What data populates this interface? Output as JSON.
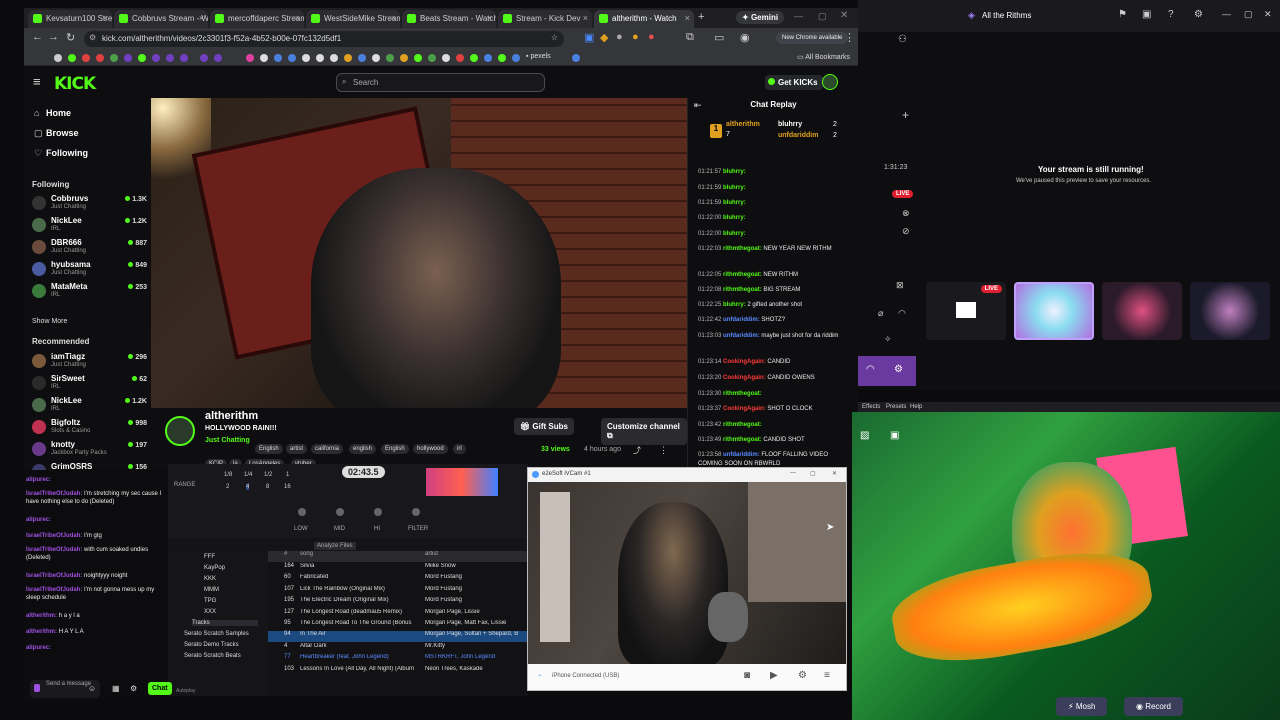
{
  "browser": {
    "tabs": [
      {
        "label": "Kevsaturn100 Stream"
      },
      {
        "label": "Cobbruvs Stream - W"
      },
      {
        "label": "mercoffdaperc Stream"
      },
      {
        "label": "WestSideMike Stream"
      },
      {
        "label": "Beats Stream - Watch"
      },
      {
        "label": "Stream - Kick Dev"
      },
      {
        "label": "altherithm - Watch"
      }
    ],
    "gemini": "Gemini",
    "url": "kick.com/altherithm/videos/2c3301f3-f52a-4b52-b00e-07fc132d5df1",
    "new_chrome": "New Chrome available",
    "all_bookmarks": "All Bookmarks",
    "pexels": "pexels"
  },
  "kick": {
    "logo": "KICK",
    "search_placeholder": "Search",
    "get_kicks": "Get KICKs",
    "nav": [
      {
        "label": "Home"
      },
      {
        "label": "Browse"
      },
      {
        "label": "Following"
      }
    ],
    "following_head": "Following",
    "following": [
      {
        "name": "Cobbruvs",
        "cat": "Just Chatting",
        "views": "1.3K"
      },
      {
        "name": "NickLee",
        "cat": "IRL",
        "views": "1.2K"
      },
      {
        "name": "DBR666",
        "cat": "Just Chatting",
        "views": "887"
      },
      {
        "name": "hyubsama",
        "cat": "Just Chatting",
        "views": "849"
      },
      {
        "name": "MataMeta",
        "cat": "IRL",
        "views": "253"
      }
    ],
    "show_more": "Show More",
    "recommended_head": "Recommended",
    "recommended": [
      {
        "name": "iamTiagz",
        "cat": "Just Chatting",
        "views": "296"
      },
      {
        "name": "SirSweet",
        "cat": "IRL",
        "views": "62"
      },
      {
        "name": "NickLee",
        "cat": "IRL",
        "views": "1.2K"
      },
      {
        "name": "Bigfoltz",
        "cat": "Slots & Casino",
        "views": "998"
      },
      {
        "name": "knotty",
        "cat": "Jackbox Party Packs",
        "views": "197"
      },
      {
        "name": "GrimOSRS",
        "cat": "",
        "views": "156"
      }
    ],
    "channel": {
      "name": "altherithm",
      "title": "HOLLYWOOD RAIN!!!",
      "category": "Just Chatting",
      "tags1": [
        "English",
        "artist",
        "california",
        "english",
        "English",
        "hollywood",
        "irl"
      ],
      "tags2": [
        "KCIP",
        "la",
        "LosAngeles",
        "vtuber"
      ],
      "gift_subs": "Gift Subs",
      "customize": "Customize channel",
      "views": "33 views",
      "ago": "4 hours ago"
    },
    "chat": {
      "header": "Chat Replay",
      "gifters": [
        {
          "name": "altherithm",
          "n": "7"
        },
        {
          "name": "bluhrry",
          "n": "2"
        },
        {
          "name": "unfdariddim",
          "n": "2"
        }
      ],
      "messages": [
        {
          "t": "01:21:57",
          "u": "bluhrry:",
          "m": "",
          "c": "#53fc18"
        },
        {
          "t": "01:21:59",
          "u": "bluhrry:",
          "m": "",
          "c": "#53fc18"
        },
        {
          "t": "01:21:59",
          "u": "bluhrry:",
          "m": "",
          "c": "#53fc18"
        },
        {
          "t": "01:22:00",
          "u": "bluhrry:",
          "m": "",
          "c": "#53fc18"
        },
        {
          "t": "01:22:00",
          "u": "bluhrry:",
          "m": "",
          "c": "#53fc18"
        },
        {
          "t": "01:22:03",
          "u": "rithmthegoat:",
          "m": "NEW YEAR NEW RITHM",
          "c": "#53fc18"
        },
        {
          "t": "01:22:05",
          "u": "rithmthegoat:",
          "m": "NEW RITHM",
          "c": "#53fc18"
        },
        {
          "t": "01:22:08",
          "u": "rithmthegoat:",
          "m": "BIG STREAM",
          "c": "#53fc18"
        },
        {
          "t": "01:22:25",
          "u": "bluhrry:",
          "m": "2 gifted another shot",
          "c": "#53fc18"
        },
        {
          "t": "01:22:42",
          "u": "unfdariddim:",
          "m": "SHOTZ?",
          "c": "#5a8aff"
        },
        {
          "t": "01:23:03",
          "u": "unfdariddim:",
          "m": "maybe just shot for da riddim",
          "c": "#5a8aff"
        },
        {
          "t": "01:23:14",
          "u": "CookingAgain:",
          "m": "CANDID",
          "c": "#ff3a3a"
        },
        {
          "t": "01:23:20",
          "u": "CookingAgain:",
          "m": "CANDID OWENS",
          "c": "#ff3a3a"
        },
        {
          "t": "01:23:30",
          "u": "rithmthegoat:",
          "m": "",
          "c": "#53fc18"
        },
        {
          "t": "01:23:37",
          "u": "CookingAgain:",
          "m": "SHOT O CLOCK",
          "c": "#ff3a3a"
        },
        {
          "t": "01:23:42",
          "u": "rithmthegoat:",
          "m": "",
          "c": "#53fc18"
        },
        {
          "t": "01:23:49",
          "u": "rithmthegoat:",
          "m": "CANDID SHOT",
          "c": "#53fc18"
        },
        {
          "t": "01:23:58",
          "u": "unfdariddim:",
          "m": "FLOOF FALLING VIDEO COMING SOON ON RBWRLD",
          "c": "#5a8aff"
        }
      ]
    }
  },
  "streamapp": {
    "title": "All the Rithms",
    "timer": "1:31:23",
    "live": "LIVE",
    "running": "Your stream is still running!",
    "paused": "We've paused this preview to save your resources.",
    "thumb_live": "LIVE"
  },
  "obs_menu": [
    "Effects",
    "Presets",
    "Help"
  ],
  "colorcam": {
    "mosh": "Mosh",
    "record": "Record"
  },
  "dj": {
    "time": "02:43.5",
    "loops": [
      "1/8",
      "1/4",
      "1/2",
      "1",
      "2",
      "4",
      "8",
      "16"
    ],
    "range": "RANGE",
    "knobs": [
      "LOW",
      "MID",
      "HI",
      "FILTER"
    ],
    "analyze": "Analyze Files",
    "col_song": "song",
    "col_artist": "artist",
    "tree": [
      "FFF",
      "KayPop",
      "KKK",
      "MMM",
      "TPG",
      "XXX",
      "Tracks",
      "Serato Scratch Samples",
      "Serato Demo Tracks",
      "Serato Scratch Beats"
    ],
    "autoplay": "Autoplay",
    "rows": [
      {
        "n": "164",
        "s": "Silvia",
        "a": "Miike Snow"
      },
      {
        "n": "60",
        "s": "Fabricated",
        "a": "Mord Fustang"
      },
      {
        "n": "107",
        "s": "Lick The Rainbow (Original Mix)",
        "a": "Mord Fustang"
      },
      {
        "n": "195",
        "s": "The Electric Dream (Original Mix)",
        "a": "Mord Fustang"
      },
      {
        "n": "127",
        "s": "The Longest Road (deadmau5 Remix)",
        "a": "Morgan Page, Lissie"
      },
      {
        "n": "95",
        "s": "The Longest Road To The Ground (Bonus",
        "a": "Morgan Page, Matt Fax, Lissie"
      },
      {
        "n": "94",
        "s": "In The Air",
        "a": "Morgan Page, Sultan + Shepard, B"
      },
      {
        "n": "4",
        "s": "Altar Dark",
        "a": "Mr.Kitty"
      },
      {
        "n": "77",
        "s": "Heartbreaker (feat. John Legend)",
        "a": "MSTRKRFT, John Legend"
      },
      {
        "n": "103",
        "s": "Lessons In Love (All Day, All Night) (Album",
        "a": "Neon Trees, Kaskade"
      }
    ]
  },
  "leftchat": {
    "messages": [
      {
        "u": "alipurec:",
        "m": ""
      },
      {
        "u": "IsraelTribeOfJudah:",
        "m": "I'm stretching my sec cause I have nothing else to do (Deleted)"
      },
      {
        "u": "alipurec:",
        "m": ""
      },
      {
        "u": "IsraelTribeOfJudah:",
        "m": "I'm gtg"
      },
      {
        "u": "IsraelTribeOfJudah:",
        "m": "with cum soaked undies (Deleted)"
      },
      {
        "u": "IsraelTribeOfJudah:",
        "m": "noightyyy noight"
      },
      {
        "u": "IsraelTribeOfJudah:",
        "m": "I'm not gonna mess up my sleep schedule"
      },
      {
        "u": "altherithm:",
        "m": "h a y l a"
      },
      {
        "u": "altherithm:",
        "m": "H A Y L A"
      },
      {
        "u": "alipurec:",
        "m": ""
      }
    ],
    "send": "Send a message",
    "chat_btn": "Chat"
  },
  "ivcam": {
    "title": "e2eSoft iVCam #1",
    "connected": "iPhone Connected (USB)"
  }
}
